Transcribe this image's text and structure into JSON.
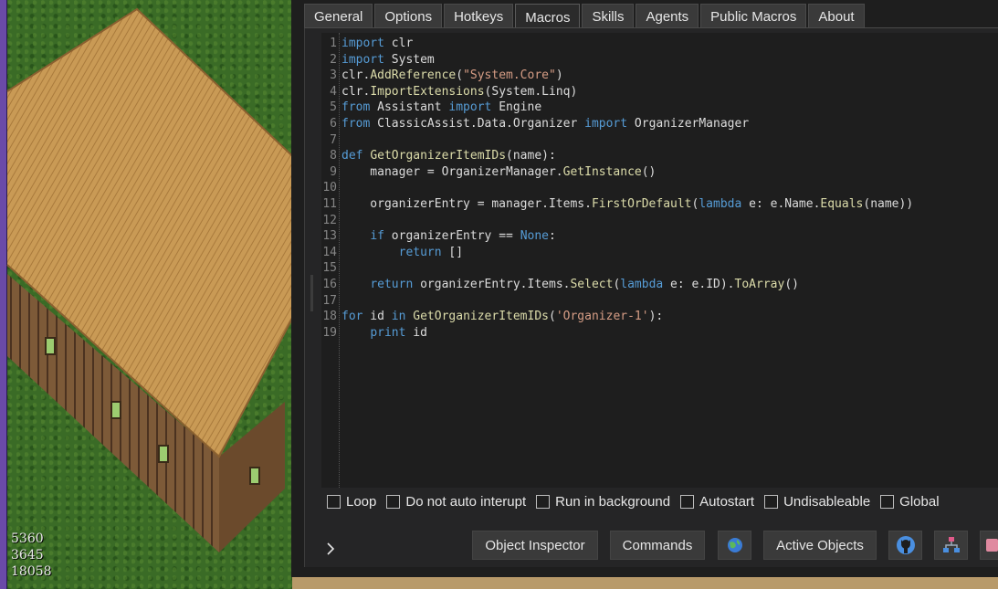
{
  "tabs": [
    {
      "label": "General"
    },
    {
      "label": "Options"
    },
    {
      "label": "Hotkeys"
    },
    {
      "label": "Macros",
      "active": true
    },
    {
      "label": "Skills"
    },
    {
      "label": "Agents"
    },
    {
      "label": "Public Macros"
    },
    {
      "label": "About"
    }
  ],
  "editor": {
    "line_numbers": [
      "1",
      "2",
      "3",
      "4",
      "5",
      "6",
      "7",
      "8",
      "9",
      "10",
      "11",
      "12",
      "13",
      "14",
      "15",
      "16",
      "17",
      "18",
      "19"
    ],
    "code_lines": [
      "import clr",
      "import System",
      "clr.AddReference(\"System.Core\")",
      "clr.ImportExtensions(System.Linq)",
      "from Assistant import Engine",
      "from ClassicAssist.Data.Organizer import OrganizerManager",
      "",
      "def GetOrganizerItemIDs(name):",
      "    manager = OrganizerManager.GetInstance()",
      "",
      "    organizerEntry = manager.Items.FirstOrDefault(lambda e: e.Name.Equals(name))",
      "",
      "    if organizerEntry == None:",
      "        return []",
      "",
      "    return organizerEntry.Items.Select(lambda e: e.ID).ToArray()",
      "",
      "for id in GetOrganizerItemIDs('Organizer-1'):",
      "    print id"
    ]
  },
  "options": {
    "loop": "Loop",
    "do_not_auto_interupt": "Do not auto interupt",
    "run_in_background": "Run in background",
    "autostart": "Autostart",
    "undisableable": "Undisableable",
    "global": "Global"
  },
  "buttons": {
    "object_inspector": "Object Inspector",
    "commands": "Commands",
    "active_objects": "Active Objects"
  },
  "icons": {
    "expander": "chevron-right-icon",
    "globe": "globe-icon",
    "github": "github-icon",
    "hierarchy": "hierarchy-icon"
  },
  "game": {
    "coords": [
      "5360",
      "3645",
      "18058"
    ]
  },
  "colors": {
    "window_bg": "#1e1e1e",
    "keyword": "#569cd6",
    "string": "#d69d85",
    "function": "#dcdcaa"
  }
}
